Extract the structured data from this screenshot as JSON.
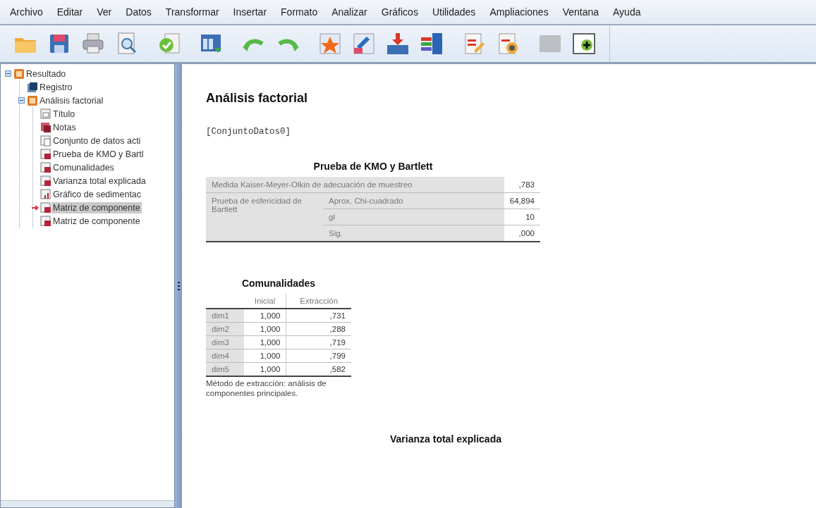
{
  "menu": [
    {
      "label": "Archivo"
    },
    {
      "label": "Editar"
    },
    {
      "label": "Ver"
    },
    {
      "label": "Datos"
    },
    {
      "label": "Transformar"
    },
    {
      "label": "Insertar"
    },
    {
      "label": "Formato"
    },
    {
      "label": "Analizar"
    },
    {
      "label": "Gráficos"
    },
    {
      "label": "Utilidades"
    },
    {
      "label": "Ampliaciones"
    },
    {
      "label": "Ventana"
    },
    {
      "label": "Ayuda"
    }
  ],
  "toolbar": [
    {
      "disabled": false
    },
    {
      "disabled": false
    },
    {
      "disabled": false
    },
    {
      "disabled": false
    },
    {
      "disabled": false
    },
    {
      "disabled": false
    },
    {
      "disabled": false
    },
    {
      "disabled": false
    },
    {
      "disabled": false
    },
    {
      "disabled": false
    },
    {
      "disabled": false
    },
    {
      "disabled": false
    },
    {
      "disabled": false
    },
    {
      "disabled": false
    },
    {
      "disabled": true
    },
    {
      "disabled": false
    }
  ],
  "outline": [
    {
      "label": "Resultado",
      "kind": "folder",
      "selected": false,
      "expanded": true,
      "children": [
        {
          "label": "Registro",
          "kind": "log",
          "selected": false
        },
        {
          "label": "Análisis factorial",
          "kind": "folder",
          "selected": false,
          "expanded": true,
          "children": [
            {
              "label": "Título",
              "kind": "heading",
              "selected": false
            },
            {
              "label": "Notas",
              "kind": "notes",
              "selected": false
            },
            {
              "label": "Conjunto de datos acti",
              "kind": "text",
              "selected": false
            },
            {
              "label": "Prueba de KMO y Bartl",
              "kind": "table",
              "selected": false
            },
            {
              "label": "Comunalidades",
              "kind": "table",
              "selected": false
            },
            {
              "label": "Varianza total explicada",
              "kind": "table",
              "selected": false
            },
            {
              "label": "Gráfico de sedimentac",
              "kind": "chart",
              "selected": false
            },
            {
              "label": "Matriz de componente",
              "kind": "table",
              "selected": true
            },
            {
              "label": "Matriz de componente",
              "kind": "table",
              "selected": false
            }
          ]
        }
      ]
    }
  ],
  "output": {
    "title": "Análisis factorial",
    "dataset": "[ConjuntoDatos0]",
    "kmo": {
      "title": "Prueba de KMO y Bartlett",
      "measure_label": "Medida Kaiser-Meyer-Olkin de adecuación de muestreo",
      "measure_value": ",783",
      "test_label": "Prueba de esfericidad de Bartlett",
      "rows": [
        {
          "label": "Aprox. Chi-cuadrado",
          "value": "64,894"
        },
        {
          "label": "gl",
          "value": "10"
        },
        {
          "label": "Sig.",
          "value": ",000"
        }
      ]
    },
    "communalities": {
      "title": "Comunalidades",
      "columns": [
        "Inicial",
        "Extracción"
      ],
      "rows": [
        {
          "label": "dim1",
          "initial": "1,000",
          "extraction": ",731"
        },
        {
          "label": "dim2",
          "initial": "1,000",
          "extraction": ",288"
        },
        {
          "label": "dim3",
          "initial": "1,000",
          "extraction": ",719"
        },
        {
          "label": "dim4",
          "initial": "1,000",
          "extraction": ",799"
        },
        {
          "label": "dim5",
          "initial": "1,000",
          "extraction": ",582"
        }
      ],
      "footnote": "Método de extracción: análisis de componentes principales."
    },
    "next_title": "Varianza total explicada"
  }
}
